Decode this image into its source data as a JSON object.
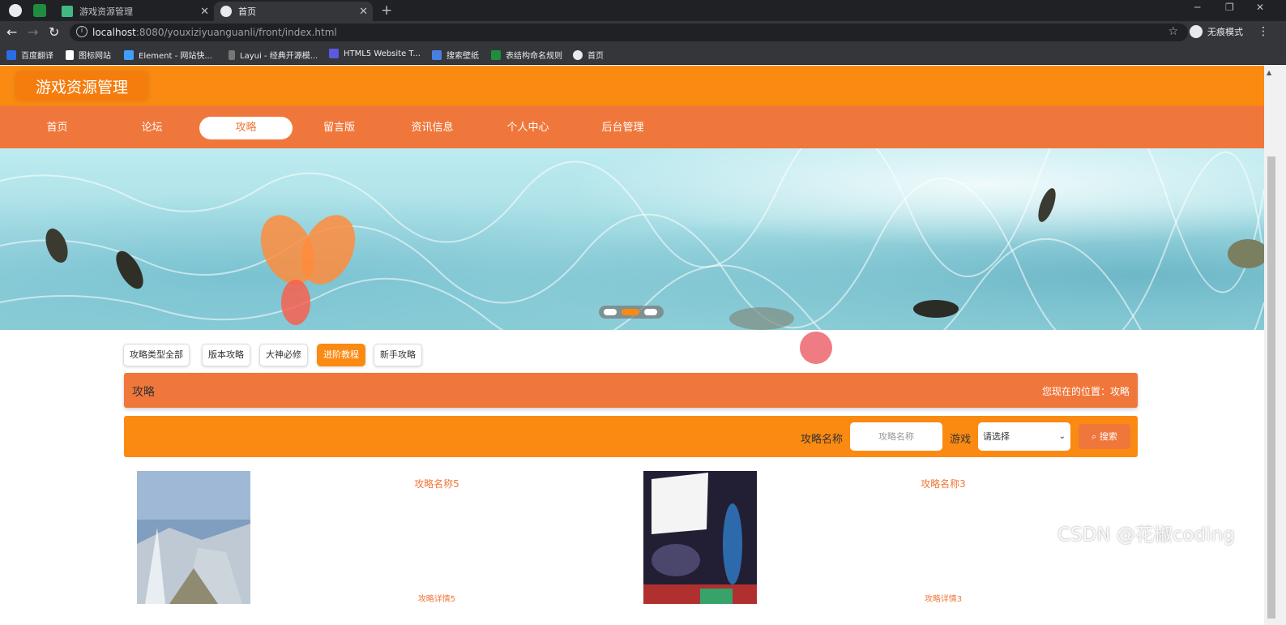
{
  "browser": {
    "tabs": [
      {
        "title": "游戏资源管理",
        "active": false
      },
      {
        "title": "首页",
        "active": true
      }
    ],
    "url_host": "localhost",
    "url_rest": ":8080/youxiziyuanguanli/front/index.html",
    "profile_label": "无痕模式",
    "bookmarks": [
      "百度翻译",
      "图标网站",
      "Element - 网站快...",
      "Layui - 经典开源模...",
      "HTML5 Website T...",
      "搜索壁纸",
      "表结构命名规则",
      "首页"
    ]
  },
  "site": {
    "logo_text": "游戏资源管理",
    "nav": [
      "首页",
      "论坛",
      "攻略",
      "留言版",
      "资讯信息",
      "个人中心",
      "后台管理"
    ],
    "nav_active_index": 2,
    "accent": "#fb8a12",
    "nav_color": "#f0773b"
  },
  "carousel": {
    "slide_count": 3,
    "active_index": 1
  },
  "filters": {
    "items": [
      "攻略类型全部",
      "版本攻略",
      "大神必修",
      "进阶教程",
      "新手攻略"
    ],
    "active_index": 3
  },
  "section": {
    "title": "攻略",
    "breadcrumb": "您现在的位置：攻略"
  },
  "search": {
    "name_label": "攻略名称",
    "name_placeholder": "攻略名称",
    "game_label": "游戏",
    "game_selected": "请选择",
    "button_label": "搜索"
  },
  "cards": [
    {
      "name": "攻略名称5",
      "detail": "攻略详情5"
    },
    {
      "name": "攻略名称3",
      "detail": "攻略详情3"
    }
  ],
  "watermark": "CSDN @花椒coding"
}
